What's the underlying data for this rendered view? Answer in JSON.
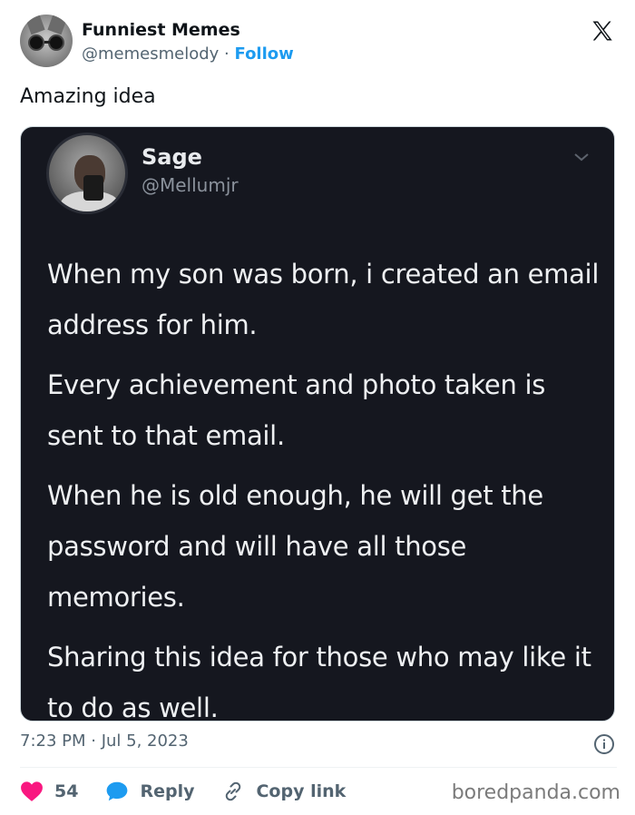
{
  "author": {
    "display_name": "Funniest Memes",
    "handle": "@memesmelody",
    "separator": "·",
    "follow_label": "Follow"
  },
  "post": {
    "text": "Amazing idea",
    "timestamp": "7:23 PM · Jul 5, 2023"
  },
  "embedded_tweet": {
    "display_name": "Sage",
    "handle": "@Mellumjr",
    "paragraphs": [
      "When my son was born, i created an email address for him.",
      "Every achievement and photo taken is sent to that email.",
      "When he is old enough, he will get the password and will have all those memories.",
      "Sharing this idea for those who may like it to do as well."
    ]
  },
  "actions": {
    "like_count": "54",
    "reply_label": "Reply",
    "copy_link_label": "Copy link"
  },
  "watermark": "boredpanda.com",
  "icons": {
    "platform": "x-logo-icon",
    "like": "heart-icon",
    "reply": "speech-bubble-icon",
    "copy": "link-icon",
    "info": "info-icon",
    "menu": "chevron-down-icon"
  },
  "colors": {
    "accent": "#1d9bf0",
    "like": "#f91880",
    "embedded_background": "#15171f"
  }
}
